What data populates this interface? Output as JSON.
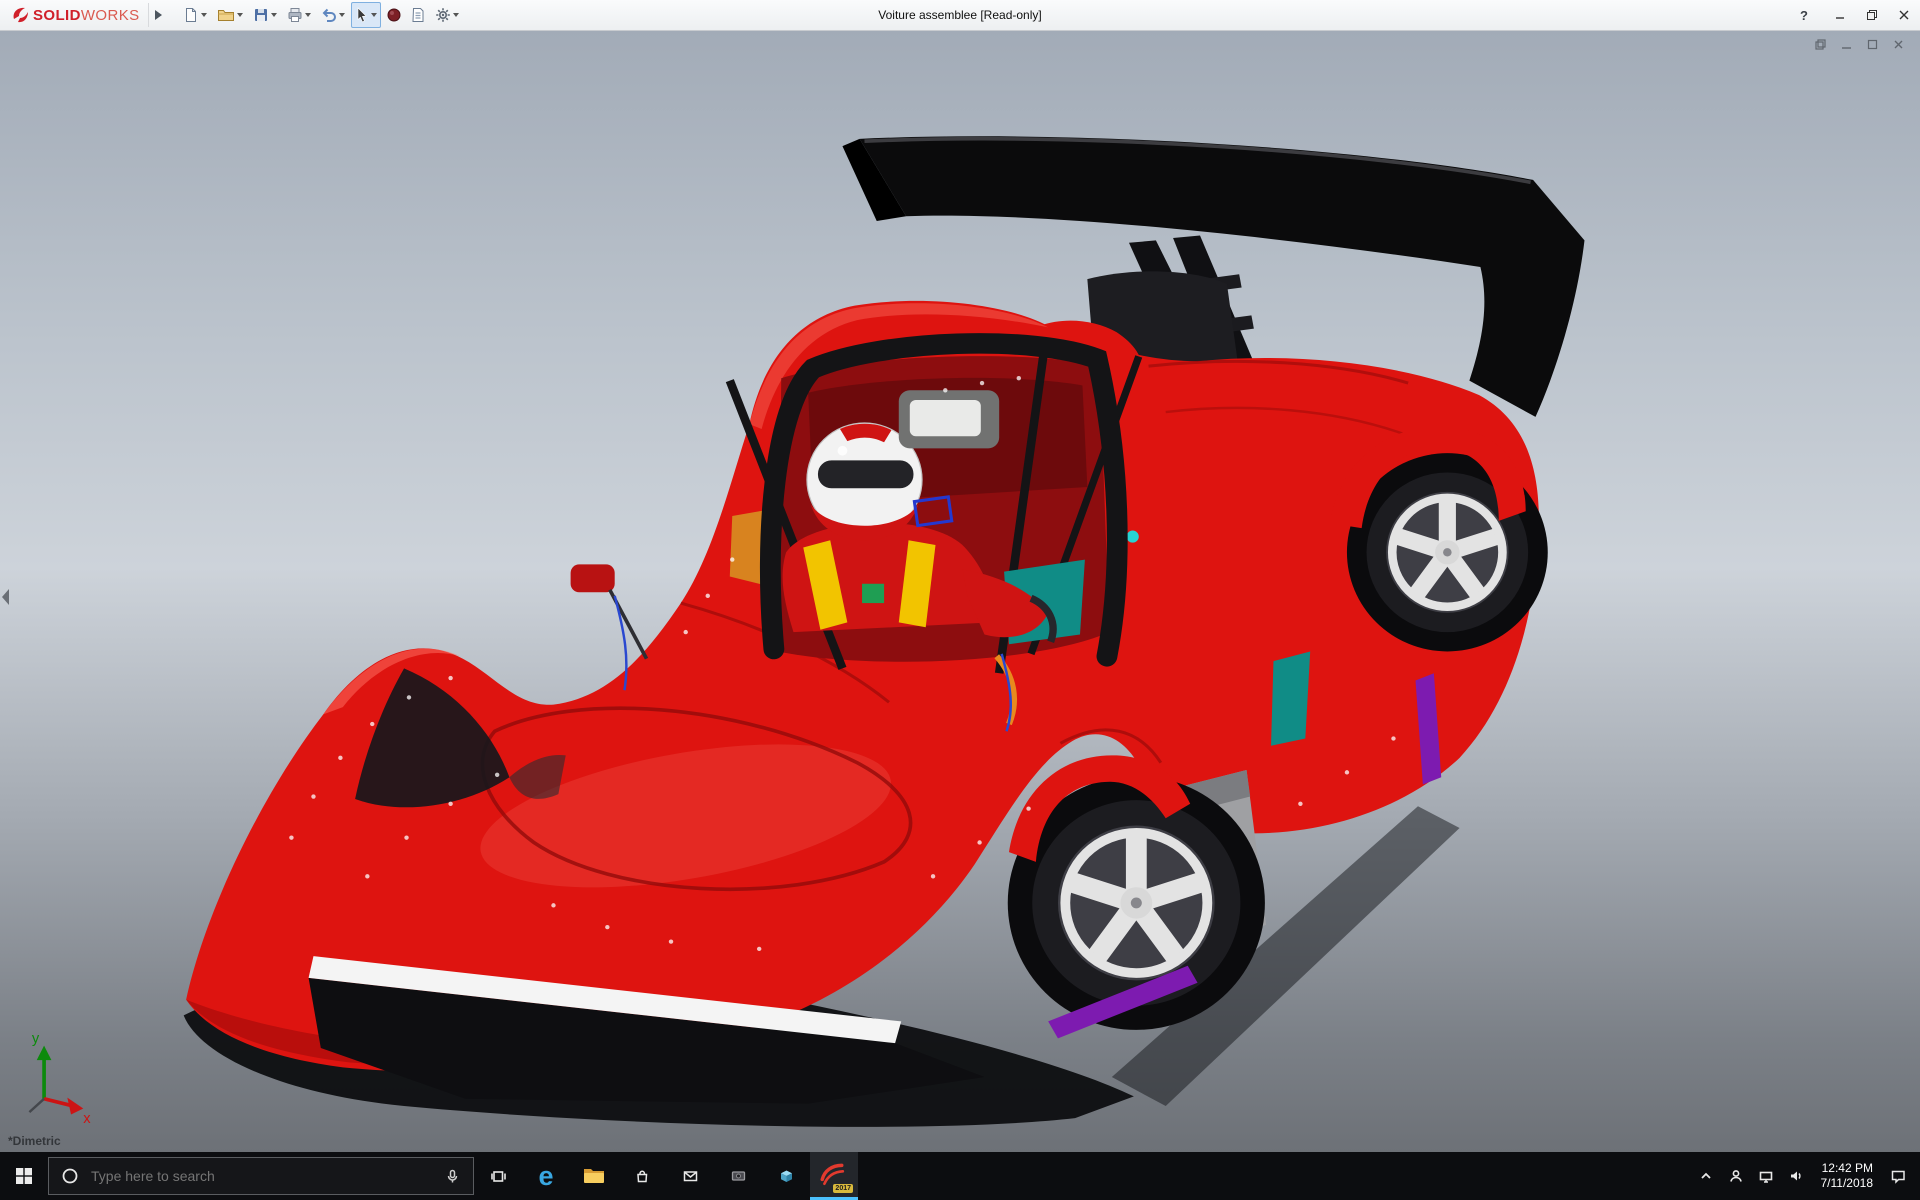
{
  "titlebar": {
    "brand_red": "#d0202a",
    "brand_solid": "SOLID",
    "brand_works": "WORKS",
    "title": "Voiture assemblee [Read-only]",
    "help_label": "?",
    "tools": [
      {
        "icon": "new-document-icon",
        "dropdown": true
      },
      {
        "icon": "open-icon",
        "dropdown": true
      },
      {
        "icon": "save-icon",
        "dropdown": true
      },
      {
        "icon": "print-icon",
        "dropdown": true
      },
      {
        "icon": "undo-icon",
        "dropdown": true
      },
      {
        "icon": "select-cursor-icon",
        "dropdown": true,
        "active": true
      },
      {
        "icon": "rebuild-icon",
        "dropdown": false
      },
      {
        "icon": "file-properties-icon",
        "dropdown": false
      },
      {
        "icon": "options-gear-icon",
        "dropdown": true
      }
    ],
    "window_controls": [
      "minimize",
      "restore",
      "close"
    ]
  },
  "viewport": {
    "orientation_label": "*Dimetric",
    "triad_x_label": "x",
    "triad_y_label": "y",
    "doc_controls": [
      "restore-down",
      "minimize",
      "maximize",
      "close"
    ]
  },
  "model": {
    "body_red": "#de1410",
    "body_shadow_red": "#9a0a0a",
    "wing_black": "#0b0b0c",
    "rim_silver": "#e3e3e3",
    "accent_teal": "#108c86",
    "accent_purple": "#7d1bb0",
    "harness_yellow": "#f2c400",
    "helmet_white": "#f2f2f2",
    "suit_red": "#cf1413"
  },
  "taskbar": {
    "search_placeholder": "Type here to search",
    "edge_letter": "e",
    "sw_year": "2017",
    "apps": [
      "start",
      "task-view",
      "edge",
      "file-explorer",
      "store",
      "mail",
      "screen-capture",
      "3d-viewer",
      "solidworks"
    ],
    "active_app": "solidworks",
    "tray_icons": [
      "hidden-icons-chevron",
      "user",
      "network",
      "volume",
      "action-center"
    ],
    "tray": {
      "time": "12:42 PM",
      "date": "7/11/2018"
    }
  }
}
